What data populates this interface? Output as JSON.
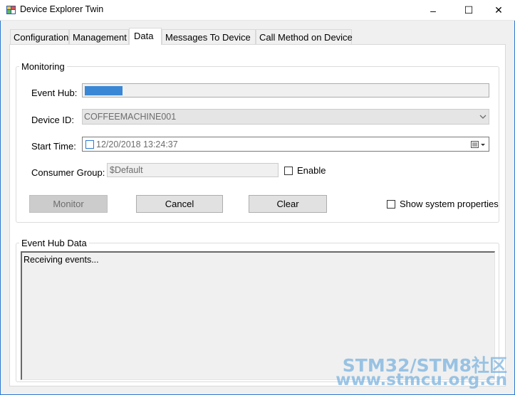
{
  "window": {
    "title": "Device Explorer Twin",
    "minimize": "–",
    "maximize": "☐",
    "close": "✕"
  },
  "tabs": [
    {
      "label": "Configuration",
      "active": false
    },
    {
      "label": "Management",
      "active": false
    },
    {
      "label": "Data",
      "active": true
    },
    {
      "label": "Messages To Device",
      "active": false
    },
    {
      "label": "Call Method on Device",
      "active": false
    }
  ],
  "monitoring": {
    "legend": "Monitoring",
    "event_hub_label": "Event Hub:",
    "device_id_label": "Device ID:",
    "device_id_value": "COFFEEMACHINE001",
    "start_time_label": "Start Time:",
    "start_time_value": "12/20/2018 13:24:37",
    "consumer_group_label": "Consumer Group:",
    "consumer_group_value": "$Default",
    "enable_label": "Enable",
    "monitor_button": "Monitor",
    "cancel_button": "Cancel",
    "clear_button": "Clear",
    "show_system_properties_label": "Show system properties"
  },
  "event_hub_data": {
    "legend": "Event Hub Data",
    "text": "Receiving events..."
  },
  "watermark": {
    "line1": "STM32/STM8社区",
    "line2": "www.stmcu.org.cn"
  },
  "colors": {
    "accent": "#2b79d0",
    "redacted_fill": "#3a87d6"
  }
}
